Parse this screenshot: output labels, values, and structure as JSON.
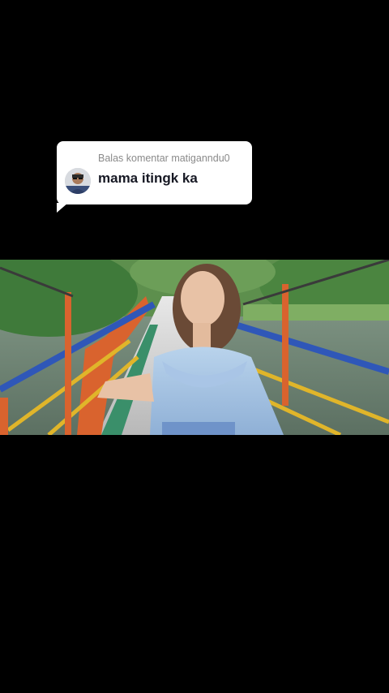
{
  "reply": {
    "header": "Balas komentar matiganndu0",
    "comment": "mama itingk ka"
  },
  "icons": {
    "avatar": "user-avatar",
    "video": "video-frame"
  },
  "colors": {
    "background": "#000000",
    "bubble": "#ffffff",
    "header_text": "#8a8a8a",
    "comment_text": "#161823"
  }
}
